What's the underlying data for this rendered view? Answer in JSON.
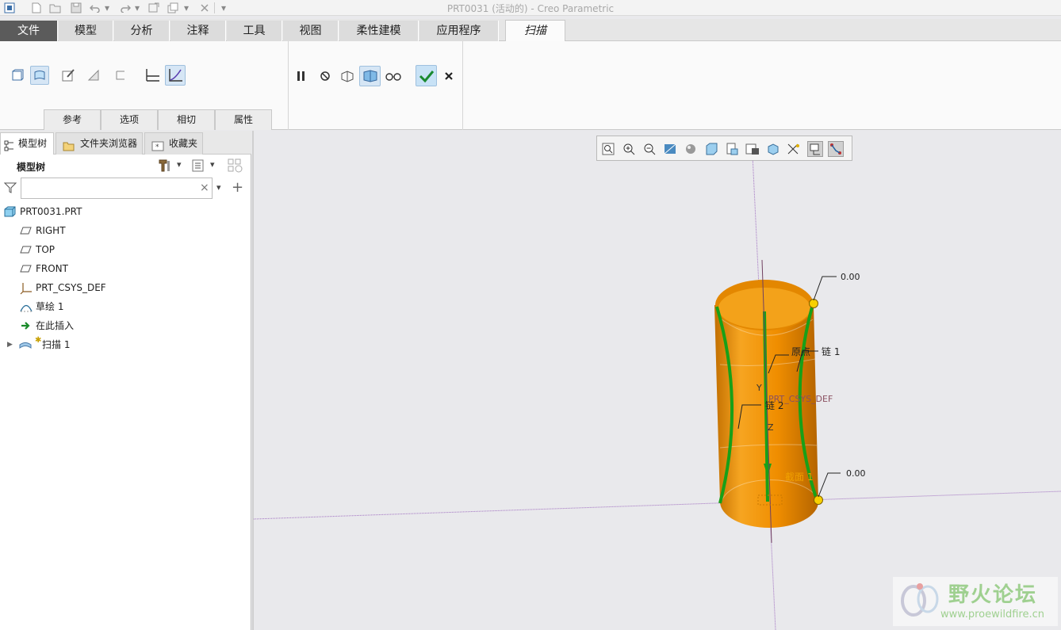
{
  "window": {
    "title": "PRT0031 (活动的) - Creo Parametric"
  },
  "ribbon_tabs": [
    {
      "label": "文件"
    },
    {
      "label": "模型"
    },
    {
      "label": "分析"
    },
    {
      "label": "注释"
    },
    {
      "label": "工具"
    },
    {
      "label": "视图"
    },
    {
      "label": "柔性建模"
    },
    {
      "label": "应用程序"
    },
    {
      "label": "扫描"
    }
  ],
  "sweep_panels": [
    {
      "label": "参考"
    },
    {
      "label": "选项"
    },
    {
      "label": "相切"
    },
    {
      "label": "属性"
    }
  ],
  "nav_tabs": [
    {
      "label": "模型树"
    },
    {
      "label": "文件夹浏览器"
    },
    {
      "label": "收藏夹"
    }
  ],
  "model_tree": {
    "header": "模型树",
    "filter_value": "",
    "items": [
      {
        "label": "PRT0031.PRT",
        "icon": "part-icon"
      },
      {
        "label": "RIGHT",
        "icon": "datum-plane-icon"
      },
      {
        "label": "TOP",
        "icon": "datum-plane-icon"
      },
      {
        "label": "FRONT",
        "icon": "datum-plane-icon"
      },
      {
        "label": "PRT_CSYS_DEF",
        "icon": "csys-icon"
      },
      {
        "label": "草绘 1",
        "icon": "sketch-icon"
      },
      {
        "label": "在此插入",
        "icon": "insert-arrow-icon"
      },
      {
        "label": "扫描 1",
        "icon": "sweep-feature-icon"
      }
    ]
  },
  "scene_annotations": {
    "top_value": "0.00",
    "bottom_value": "0.00",
    "chain1": "链 1",
    "chain2": "链 2",
    "origin": "原点",
    "csys": "PRT_CSYS_DEF",
    "section": "截面 1",
    "axis_y": "Y",
    "axis_z": "Z"
  },
  "colors": {
    "accent_file_tab": "#5b5b5b",
    "solid_orange": "#f09a00",
    "trajectory_green": "#18a018",
    "handle_yellow": "#f8d000"
  },
  "watermark": {
    "text": "野火论坛",
    "url": "www.proewildfire.cn"
  }
}
